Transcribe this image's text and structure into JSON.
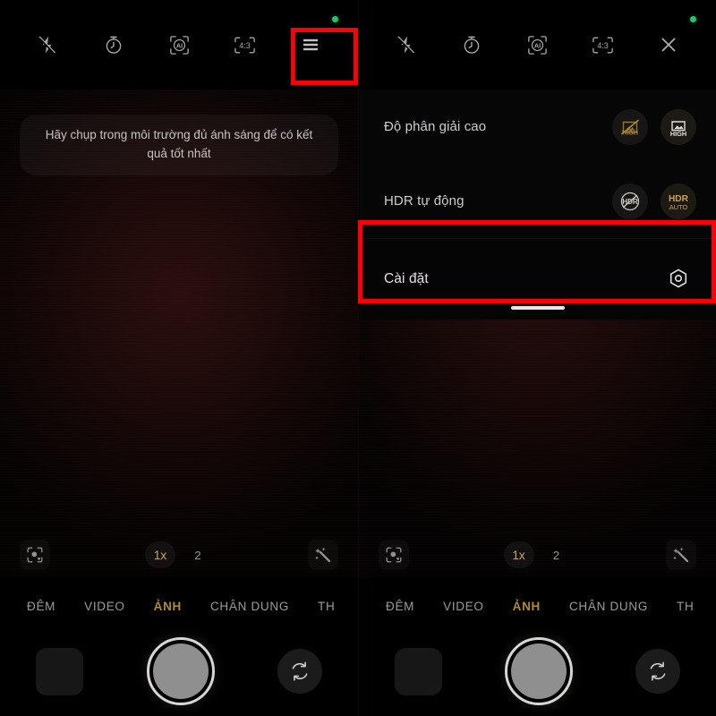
{
  "app": {
    "name": "Camera",
    "status_indicator": "green-privacy-dot"
  },
  "colors": {
    "accent_gold": "#b08a2e",
    "accent_gold_light": "#c8a75e",
    "annotation_red": "#fb0007",
    "text_primary": "#e4e1df",
    "text_secondary": "#9f9a97",
    "background": "#000000"
  },
  "left_panel": {
    "topbar": {
      "icons": [
        {
          "name": "flash-off-icon",
          "label": "Flash off"
        },
        {
          "name": "timer-icon",
          "label": "Timer"
        },
        {
          "name": "ai-scene-icon",
          "label": "AI"
        },
        {
          "name": "aspect-ratio-icon",
          "label": "4:3"
        },
        {
          "name": "menu-icon",
          "label": "More settings"
        }
      ]
    },
    "hint": "Hãy chụp trong môi trường đủ ánh sáng để có kết quả tốt nhất",
    "zoombar": {
      "lens_button": "lens-scan-icon",
      "levels": [
        {
          "label": "1x",
          "active": true
        },
        {
          "label": "2",
          "active": false
        }
      ],
      "filter_button": "magic-wand-icon"
    },
    "modes": [
      {
        "label": "ĐÊM",
        "active": false
      },
      {
        "label": "VIDEO",
        "active": false
      },
      {
        "label": "ẢNH",
        "active": true
      },
      {
        "label": "CHÂN DUNG",
        "active": false
      },
      {
        "label": "TH",
        "active": false
      }
    ],
    "bottombar": {
      "gallery_thumb": "gallery-thumbnail",
      "shutter": "shutter-button",
      "flip": "flip-camera-icon"
    }
  },
  "right_panel": {
    "topbar": {
      "icons": [
        {
          "name": "flash-off-icon",
          "label": "Flash off"
        },
        {
          "name": "timer-icon",
          "label": "Timer"
        },
        {
          "name": "ai-scene-icon",
          "label": "AI"
        },
        {
          "name": "aspect-ratio-icon",
          "label": "4:3"
        },
        {
          "name": "close-icon",
          "label": "Close"
        }
      ]
    },
    "settings_menu": {
      "rows": [
        {
          "label": "Độ phân giải cao",
          "options": [
            {
              "name": "high-res-off-icon",
              "text": "HIGH",
              "selected": false,
              "struck": true
            },
            {
              "name": "high-res-on-icon",
              "text": "HIGH",
              "selected": true,
              "struck": false
            }
          ]
        },
        {
          "label": "HDR tự động",
          "options": [
            {
              "name": "hdr-off-icon",
              "text": "HDR",
              "selected": false,
              "struck": true
            },
            {
              "name": "hdr-auto-icon",
              "text": "HDR",
              "subtext": "AUTO",
              "selected": true,
              "struck": false
            }
          ]
        }
      ],
      "settings_row": {
        "label": "Cài đặt",
        "icon": "gear-hex-icon"
      },
      "drag_handle": "sheet-drag-handle"
    },
    "zoombar": {
      "lens_button": "lens-scan-icon",
      "levels": [
        {
          "label": "1x",
          "active": true
        },
        {
          "label": "2",
          "active": false
        }
      ],
      "filter_button": "magic-wand-icon"
    },
    "modes": [
      {
        "label": "ĐÊM",
        "active": false
      },
      {
        "label": "VIDEO",
        "active": false
      },
      {
        "label": "ẢNH",
        "active": true
      },
      {
        "label": "CHÂN DUNG",
        "active": false
      },
      {
        "label": "TH",
        "active": false
      }
    ],
    "bottombar": {
      "gallery_thumb": "gallery-thumbnail",
      "shutter": "shutter-button",
      "flip": "flip-camera-icon"
    }
  },
  "annotations": [
    {
      "name": "highlight-menu-button",
      "target": "menu-icon"
    },
    {
      "name": "highlight-settings-row",
      "target": "settings-row"
    }
  ]
}
